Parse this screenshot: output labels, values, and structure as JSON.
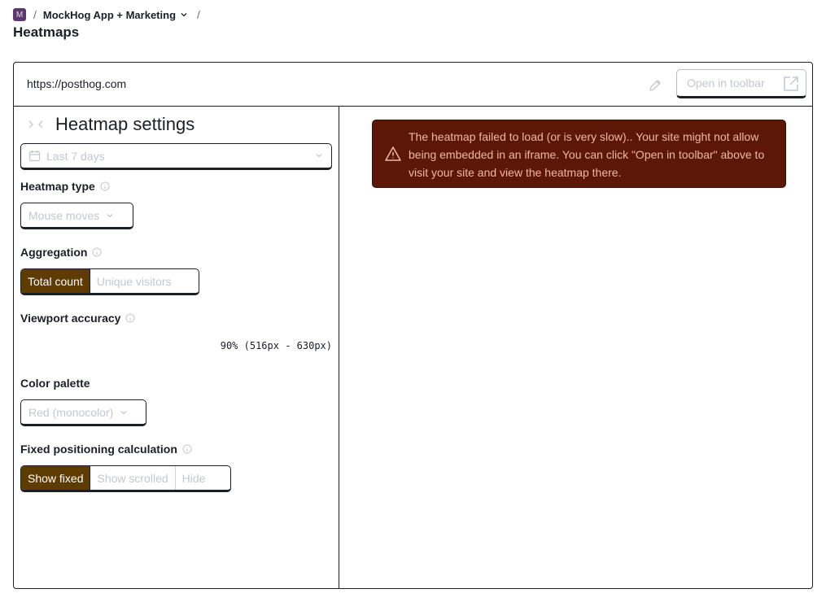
{
  "breadcrumb": {
    "avatar_letter": "M",
    "separator": "/",
    "project_name": "MockHog App + Marketing"
  },
  "page": {
    "title": "Heatmaps"
  },
  "url_bar": {
    "url": "https://posthog.com",
    "open_toolbar_label": "Open in toolbar"
  },
  "sidebar": {
    "title": "Heatmap settings",
    "date_range": "Last 7 days",
    "heatmap_type": {
      "label": "Heatmap type",
      "value": "Mouse moves"
    },
    "aggregation": {
      "label": "Aggregation",
      "options": [
        "Total count",
        "Unique visitors"
      ],
      "selected": "Total count"
    },
    "viewport_accuracy": {
      "label": "Viewport accuracy",
      "value": "90% (516px - 630px)"
    },
    "color_palette": {
      "label": "Color palette",
      "value": "Red (monocolor)"
    },
    "fixed_positioning": {
      "label": "Fixed positioning calculation",
      "options": [
        "Show fixed",
        "Show scrolled",
        "Hide"
      ],
      "selected": "Show fixed"
    }
  },
  "error": {
    "message": "The heatmap failed to load (or is very slow).. Your site might not allow being embedded in an iframe. You can click \"Open in toolbar\" above to visit your site and view the heatmap there."
  },
  "colors": {
    "accent": "#5e3b00",
    "error_bg": "#5c1706",
    "error_text": "#f0b7a3",
    "border": "#1d1f27"
  },
  "icons": [
    "pencil-icon",
    "external-link-icon",
    "collapse-icon",
    "calendar-icon",
    "chevron-down-icon",
    "info-icon",
    "warning-icon"
  ]
}
